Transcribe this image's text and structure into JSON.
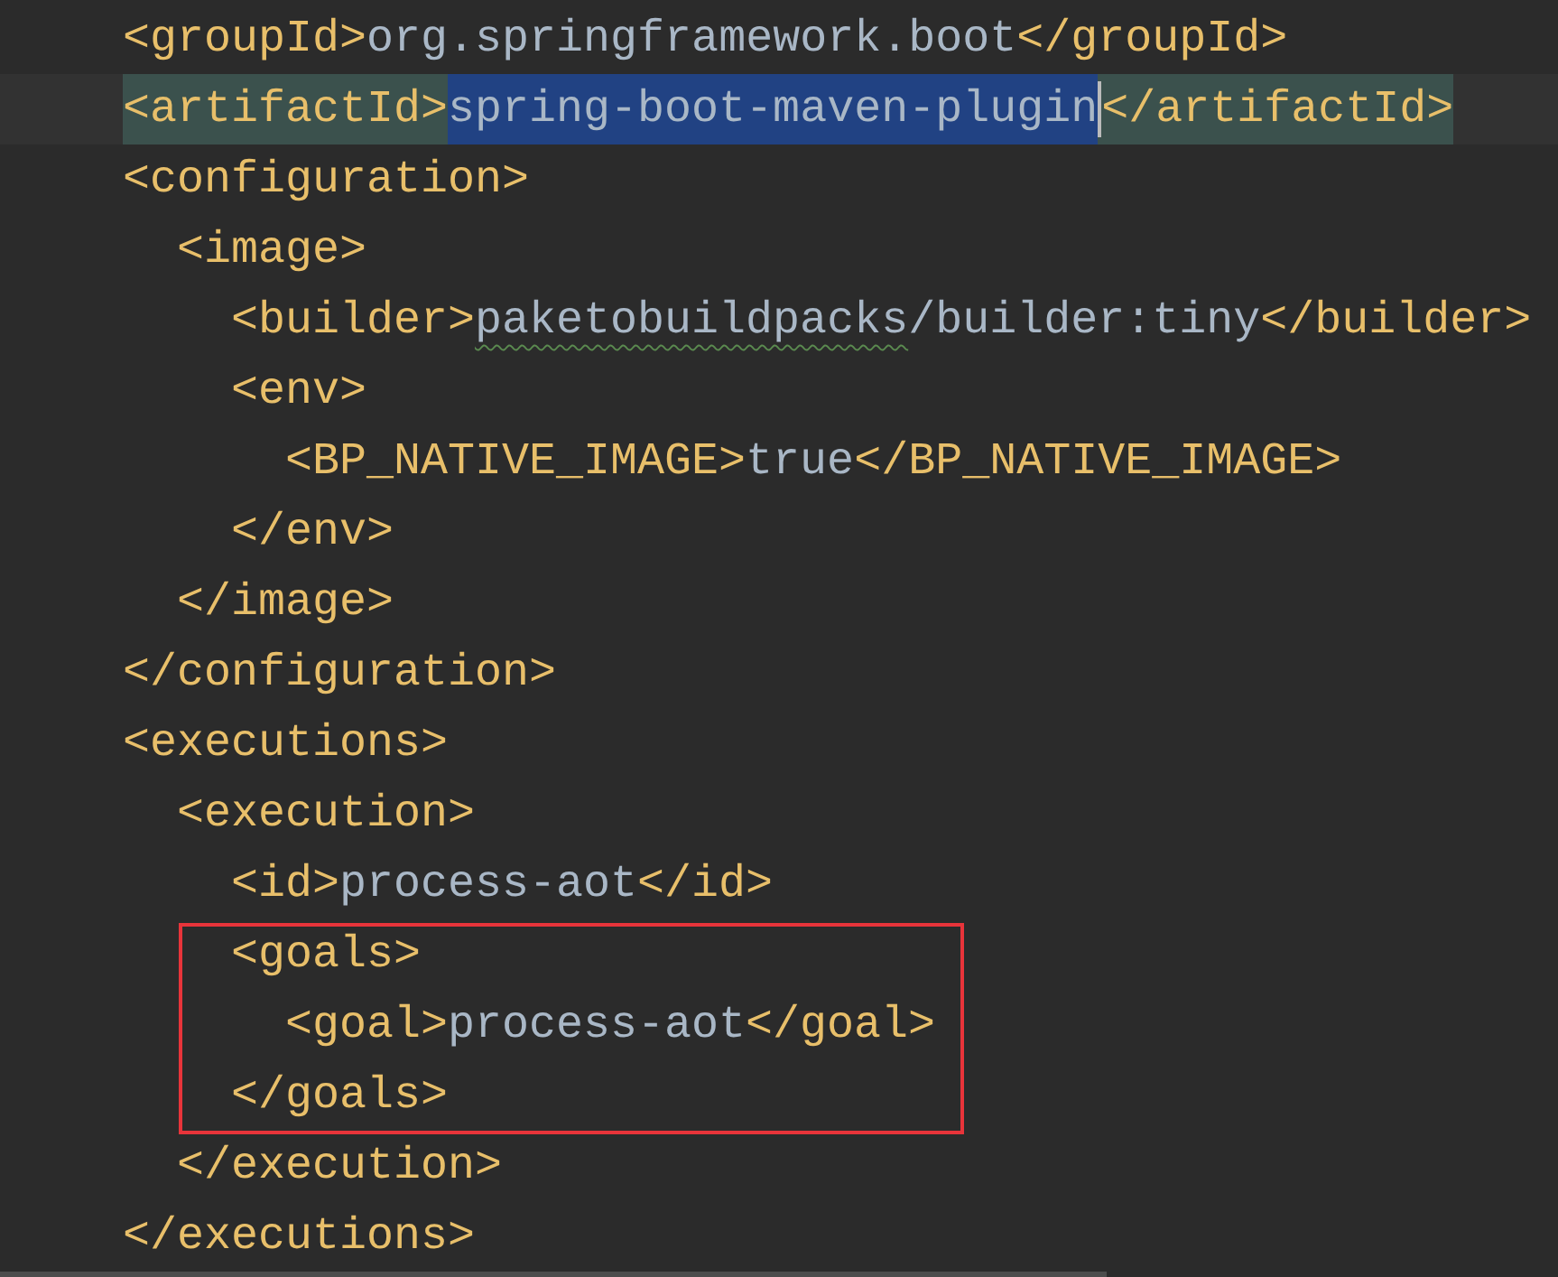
{
  "editor": {
    "lines": [
      {
        "parts": [
          {
            "kind": "tag",
            "text": "<groupId>"
          },
          {
            "kind": "text",
            "text": "org.springframework.boot"
          },
          {
            "kind": "tag",
            "text": "</groupId>"
          }
        ]
      },
      {
        "current": true,
        "matched": true,
        "parts": [
          {
            "kind": "tag",
            "text": "<artifactId>"
          },
          {
            "kind": "text",
            "text": "spring-boot-maven-plugin",
            "selected": true,
            "caret_after": true
          },
          {
            "kind": "tag",
            "text": "</artifactId>"
          }
        ]
      },
      {
        "parts": [
          {
            "kind": "tag",
            "text": "<configuration>"
          }
        ],
        "children": [
          {
            "parts": [
              {
                "kind": "tag",
                "text": "<image>"
              }
            ],
            "children": [
              {
                "parts": [
                  {
                    "kind": "tag",
                    "text": "<builder>"
                  },
                  {
                    "kind": "text",
                    "text": "paketobuildpacks",
                    "typo": true
                  },
                  {
                    "kind": "text",
                    "text": "/builder:tiny"
                  },
                  {
                    "kind": "tag",
                    "text": "</builder>"
                  }
                ]
              },
              {
                "parts": [
                  {
                    "kind": "tag",
                    "text": "<env>"
                  }
                ],
                "children": [
                  {
                    "parts": [
                      {
                        "kind": "tag",
                        "text": "<BP_NATIVE_IMAGE>"
                      },
                      {
                        "kind": "text",
                        "text": "true"
                      },
                      {
                        "kind": "tag",
                        "text": "</BP_NATIVE_IMAGE>"
                      }
                    ]
                  }
                ]
              },
              {
                "parts": [
                  {
                    "kind": "tag",
                    "text": "</env>"
                  }
                ]
              }
            ]
          },
          {
            "parts": [
              {
                "kind": "tag",
                "text": "</image>"
              }
            ]
          }
        ]
      },
      {
        "parts": [
          {
            "kind": "tag",
            "text": "</configuration>"
          }
        ]
      },
      {
        "parts": [
          {
            "kind": "tag",
            "text": "<executions>"
          }
        ],
        "children": [
          {
            "parts": [
              {
                "kind": "tag",
                "text": "<execution>"
              }
            ],
            "children": [
              {
                "parts": [
                  {
                    "kind": "tag",
                    "text": "<id>"
                  },
                  {
                    "kind": "text",
                    "text": "process-aot"
                  },
                  {
                    "kind": "tag",
                    "text": "</id>"
                  }
                ]
              },
              {
                "boxed": true,
                "parts": [
                  {
                    "kind": "tag",
                    "text": "<goals>"
                  }
                ],
                "children": [
                  {
                    "boxed": true,
                    "parts": [
                      {
                        "kind": "tag",
                        "text": "<goal>"
                      },
                      {
                        "kind": "text",
                        "text": "process-aot"
                      },
                      {
                        "kind": "tag",
                        "text": "</goal>"
                      }
                    ]
                  }
                ]
              },
              {
                "boxed": true,
                "parts": [
                  {
                    "kind": "tag",
                    "text": "</goals>"
                  }
                ]
              }
            ]
          },
          {
            "parts": [
              {
                "kind": "tag",
                "text": "</execution>"
              }
            ]
          }
        ]
      },
      {
        "parts": [
          {
            "kind": "tag",
            "text": "</executions>"
          }
        ]
      }
    ]
  }
}
